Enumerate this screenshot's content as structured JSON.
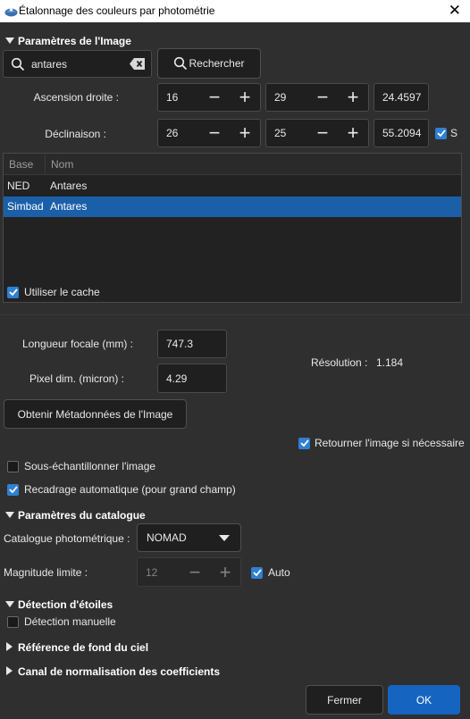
{
  "window": {
    "title": "Étalonnage des couleurs par photométrie",
    "close_glyph": "✕"
  },
  "image_params": {
    "header": "Paramètres de l'Image",
    "search": {
      "value": "antares",
      "placeholder": ""
    },
    "search_button": "Rechercher",
    "ra": {
      "label": "Ascension droite :",
      "h": "16",
      "m": "29",
      "s": "24.4597"
    },
    "dec": {
      "label": "Déclinaison :",
      "d": "26",
      "m": "25",
      "s": "55.2094",
      "sign_label": "S",
      "sign_checked": true
    },
    "table": {
      "columns": [
        "Base",
        "Nom"
      ],
      "rows": [
        {
          "base": "NED",
          "nom": "Antares",
          "selected": false
        },
        {
          "base": "Simbad",
          "nom": "Antares",
          "selected": true
        }
      ]
    },
    "use_cache": {
      "label": "Utiliser le cache",
      "checked": true
    },
    "focal": {
      "label": "Longueur focale (mm) :",
      "value": "747.3"
    },
    "pixel": {
      "label": "Pixel dim. (micron) :",
      "value": "4.29"
    },
    "resolution": {
      "label": "Résolution :",
      "value": "1.184"
    },
    "metadata_button": "Obtenir Métadonnées de l'Image",
    "flip": {
      "label": "Retourner l'image si nécessaire",
      "checked": true
    },
    "downsample": {
      "label": "Sous-échantillonner l'image",
      "checked": false
    },
    "autocrop": {
      "label": "Recadrage automatique (pour grand champ)",
      "checked": true
    }
  },
  "catalog_params": {
    "header": "Paramètres du catalogue",
    "catalog": {
      "label": "Catalogue photométrique :",
      "value": "NOMAD"
    },
    "mag_limit": {
      "label": "Magnitude limite :",
      "value": "12"
    },
    "auto": {
      "label": "Auto",
      "checked": true
    }
  },
  "star_detection": {
    "header": "Détection d'étoiles",
    "manual": {
      "label": "Détection manuelle",
      "checked": false
    }
  },
  "sky_background": {
    "header": "Référence de fond du ciel"
  },
  "normalization": {
    "header": "Canal de normalisation des coefficients"
  },
  "buttons": {
    "close": "Fermer",
    "ok": "OK"
  },
  "colors": {
    "accent": "#2f7fd2",
    "selection": "#1c5fa9",
    "ok_button": "#1565c0"
  }
}
